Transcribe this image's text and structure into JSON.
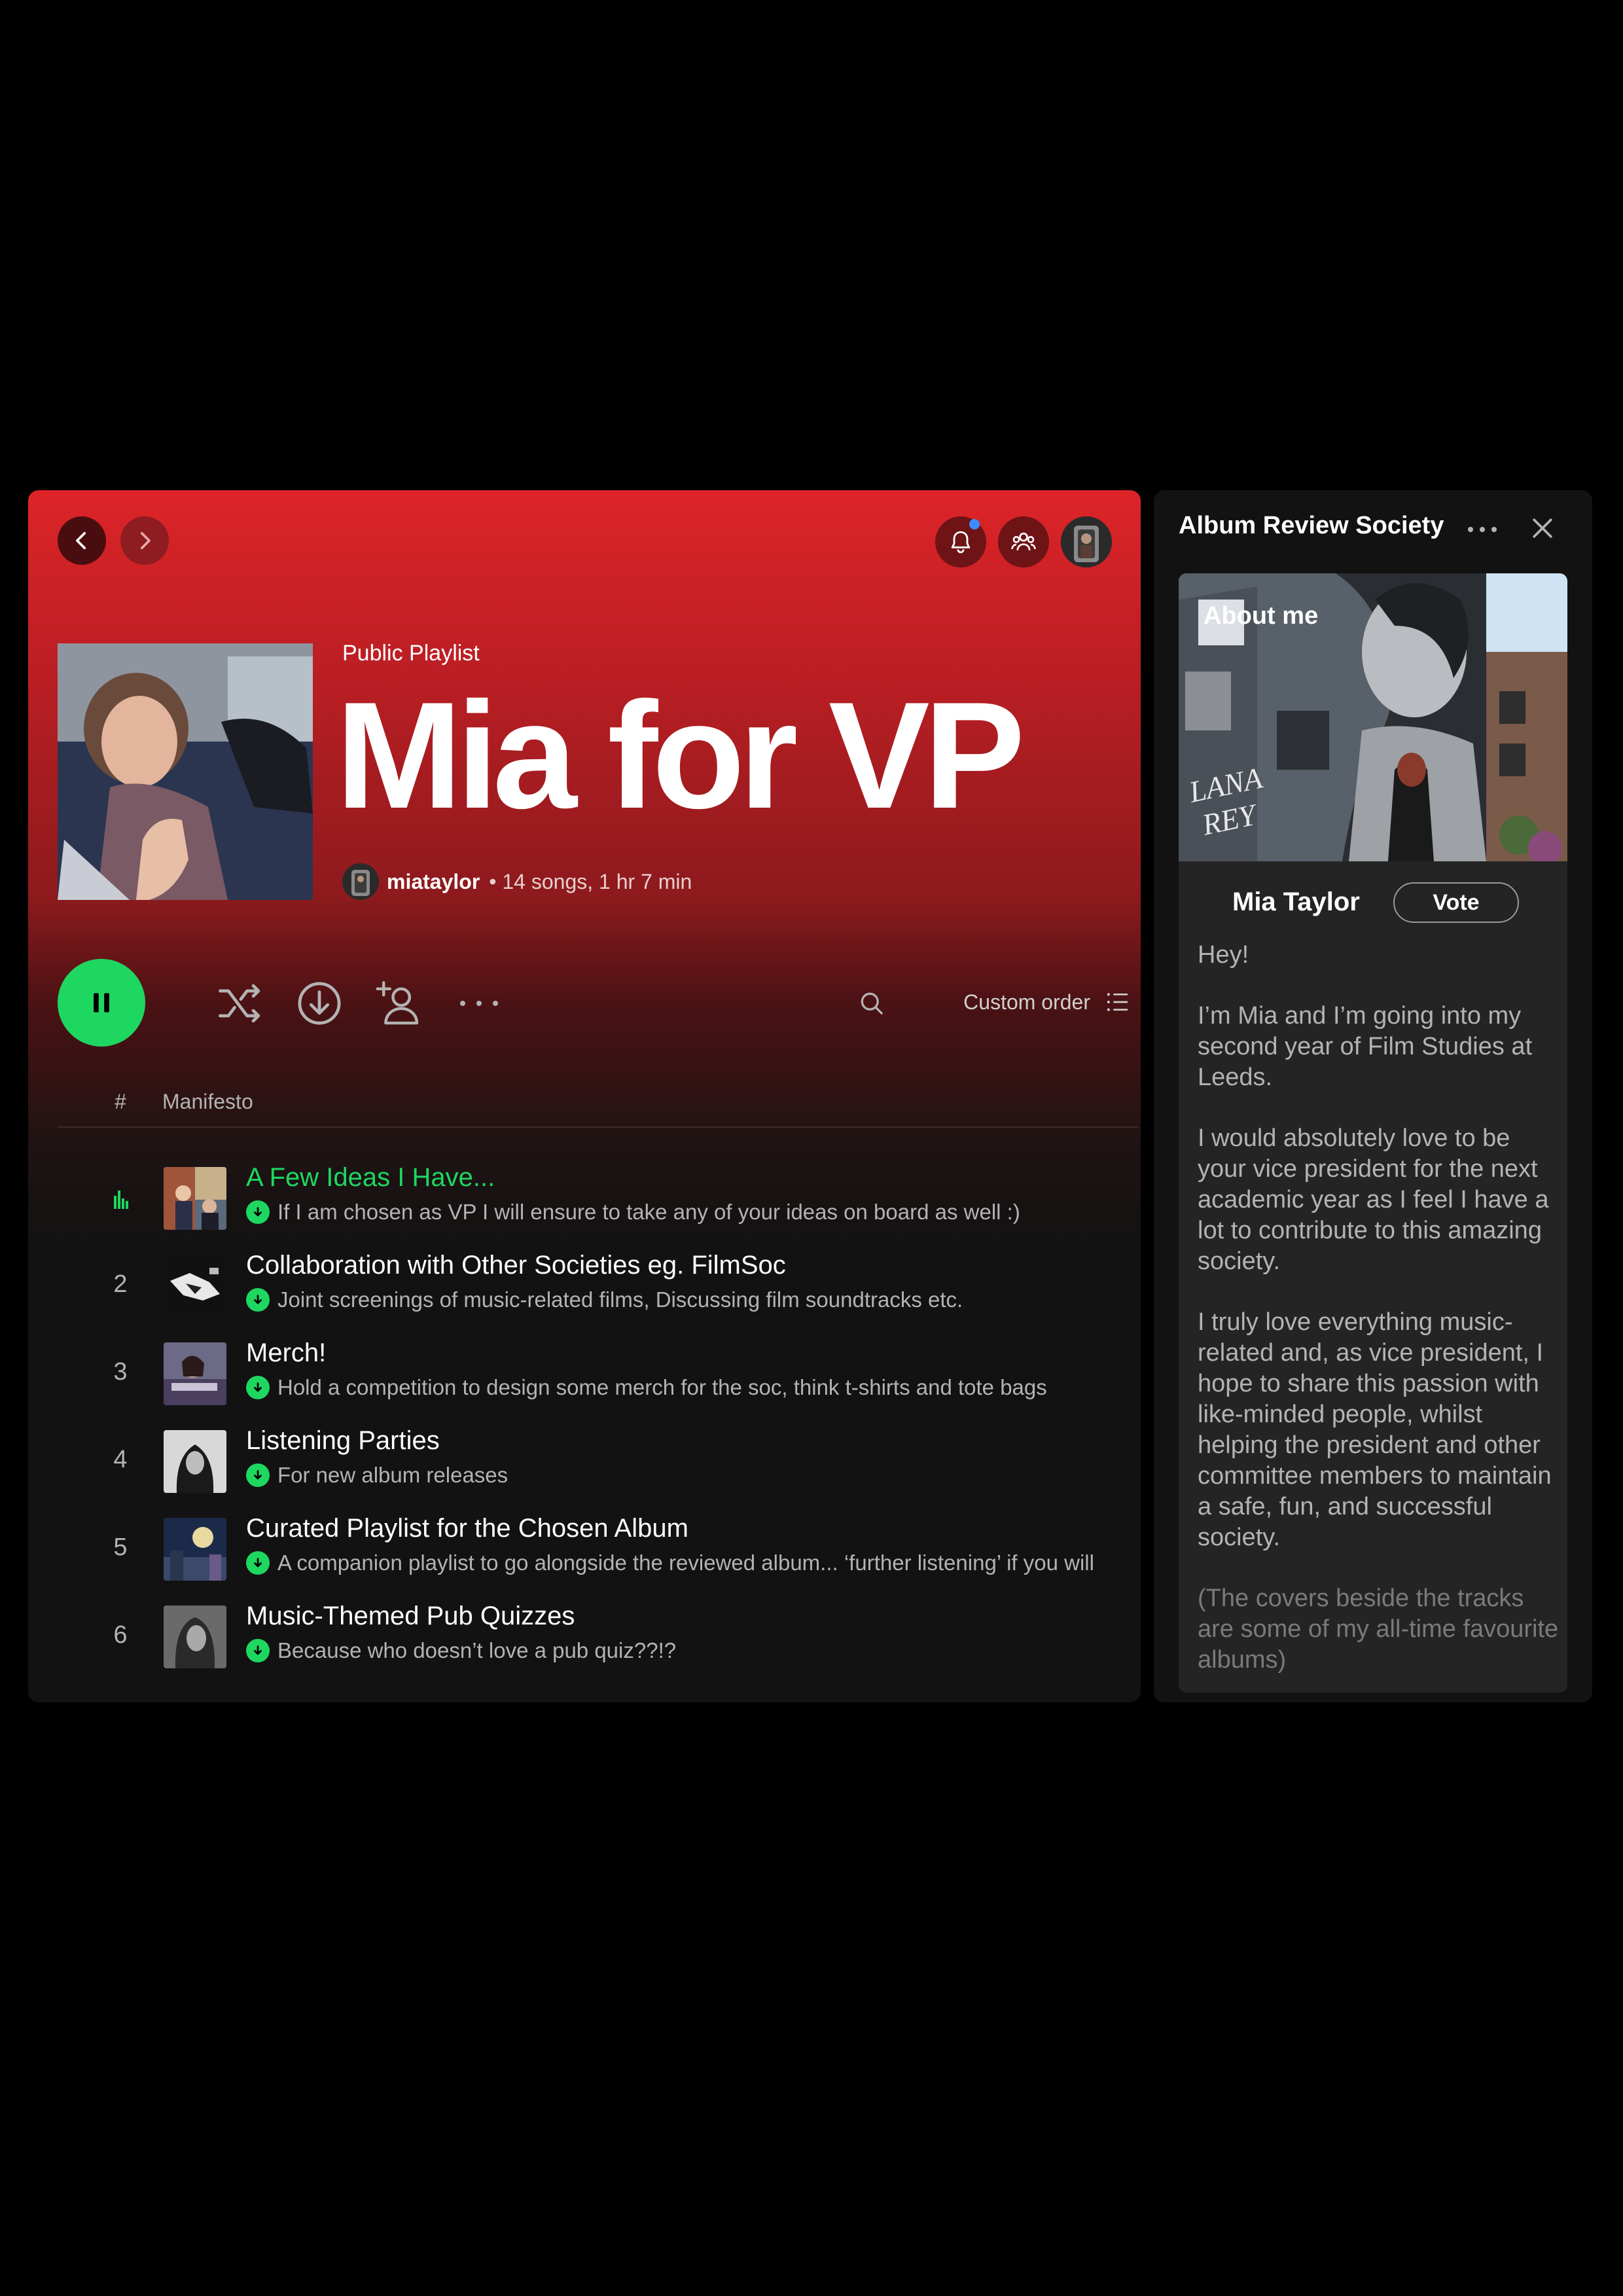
{
  "header": {
    "type_label": "Public Playlist",
    "title": "Mia for VP",
    "owner": "miataylor",
    "stats": "• 14 songs, 1 hr 7 min"
  },
  "toolbar": {
    "sort_label": "Custom order"
  },
  "list": {
    "hash": "#",
    "column": "Manifesto",
    "tracks": [
      {
        "num": "1",
        "title": "A Few Ideas I Have...",
        "desc": "If I am chosen as VP I will ensure to take any of your ideas on board as well :)",
        "playing": true
      },
      {
        "num": "2",
        "title": "Collaboration with Other Societies eg. FilmSoc",
        "desc": "Joint screenings of music-related films, Discussing film soundtracks etc."
      },
      {
        "num": "3",
        "title": "Merch!",
        "desc": "Hold a competition to design some merch for the soc, think t-shirts and tote bags"
      },
      {
        "num": "4",
        "title": "Listening Parties",
        "desc": "For new album releases"
      },
      {
        "num": "5",
        "title": "Curated Playlist for the Chosen Album",
        "desc": "A companion playlist to go alongside the reviewed album... ‘further listening’ if you will"
      },
      {
        "num": "6",
        "title": "Music-Themed Pub Quizzes",
        "desc": "Because who doesn’t love a pub quiz??!?"
      }
    ]
  },
  "side": {
    "title": "Album Review Society",
    "about_label": "About me",
    "name": "Mia Taylor",
    "vote_label": "Vote",
    "bio": [
      "Hey!",
      "I’m Mia and I’m going into my second year of Film Studies at Leeds.",
      "I would absolutely love to be your vice president for the next academic year as I feel I have a lot to contribute to this amazing society.",
      "I truly love everything music-related and, as vice president, I hope to share this passion with like-minded people, whilst helping the president and other committee members to maintain a safe, fun, and successful society.",
      "(The covers beside the tracks are some of my all-time favourite albums)"
    ]
  },
  "colors": {
    "accent": "#1ed760",
    "header_red": "#dd2428",
    "panel_bg": "#121212",
    "card_bg": "#242424"
  },
  "icons": [
    "chevron-left-icon",
    "chevron-right-icon",
    "bell-icon",
    "friends-icon",
    "pause-icon",
    "shuffle-icon",
    "download-icon",
    "add-user-icon",
    "more-icon",
    "search-icon",
    "list-icon",
    "close-icon",
    "equalizer-icon",
    "downloaded-icon"
  ]
}
